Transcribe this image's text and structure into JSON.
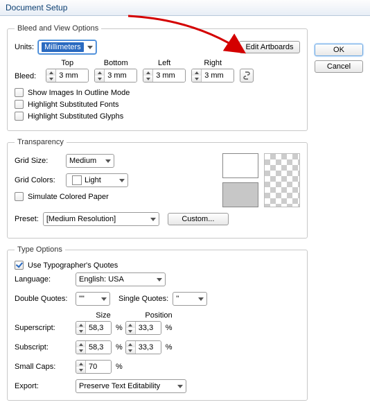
{
  "title": "Document Setup",
  "buttons": {
    "ok": "OK",
    "cancel": "Cancel",
    "edit_artboards": "Edit Artboards",
    "custom": "Custom..."
  },
  "bleed": {
    "legend": "Bleed and View Options",
    "units_label": "Units:",
    "units_value": "Millimeters",
    "bleed_label": "Bleed:",
    "top": "Top",
    "bottom": "Bottom",
    "left": "Left",
    "right": "Right",
    "val_top": "3 mm",
    "val_bottom": "3 mm",
    "val_left": "3 mm",
    "val_right": "3 mm",
    "chk1": "Show Images In Outline Mode",
    "chk2": "Highlight Substituted Fonts",
    "chk3": "Highlight Substituted Glyphs"
  },
  "trans": {
    "legend": "Transparency",
    "grid_size_label": "Grid Size:",
    "grid_size_value": "Medium",
    "grid_colors_label": "Grid Colors:",
    "grid_colors_value": "Light",
    "simulate": "Simulate Colored Paper",
    "preset_label": "Preset:",
    "preset_value": "[Medium Resolution]"
  },
  "type": {
    "legend": "Type Options",
    "typographers": "Use Typographer's Quotes",
    "typographers_checked": true,
    "language_label": "Language:",
    "language_value": "English: USA",
    "dq_label": "Double Quotes:",
    "dq_value": "\"\"",
    "sq_label": "Single Quotes:",
    "sq_value": "''",
    "size_hd": "Size",
    "pos_hd": "Position",
    "super_label": "Superscript:",
    "super_size": "58,3",
    "super_pos": "33,3",
    "sub_label": "Subscript:",
    "sub_size": "58,3",
    "sub_pos": "33,3",
    "small_label": "Small Caps:",
    "small_val": "70",
    "pct": "%",
    "export_label": "Export:",
    "export_value": "Preserve Text Editability"
  }
}
